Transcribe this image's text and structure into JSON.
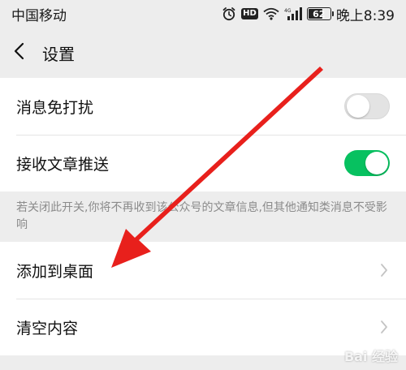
{
  "status_bar": {
    "carrier": "中国移动",
    "battery": "62",
    "time": "晚上8:39",
    "icons": [
      "alarm-icon",
      "hd-icon",
      "wifi-icon",
      "signal-4g-icon",
      "battery-icon"
    ]
  },
  "nav": {
    "title": "设置",
    "back_icon": "chevron-left-icon"
  },
  "group1": {
    "items": [
      {
        "label": "消息免打扰",
        "toggle_on": false
      },
      {
        "label": "接收文章推送",
        "toggle_on": true
      }
    ]
  },
  "hint": "若关闭此开关,你将不再收到该公众号的文章信息,但其他通知类消息不受影响",
  "group2": {
    "items": [
      {
        "label": "添加到桌面"
      },
      {
        "label": "清空内容"
      }
    ]
  },
  "colors": {
    "accent_green": "#07c160",
    "annotation_red": "#e8201c",
    "background": "#ededed"
  },
  "watermark": "Bai 经验"
}
